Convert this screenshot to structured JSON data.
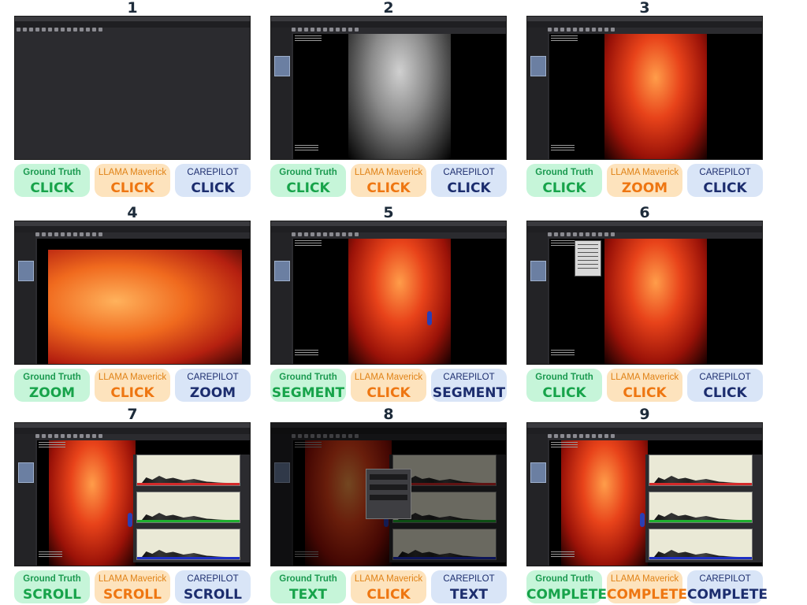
{
  "labels": {
    "ground_truth": "Ground Truth",
    "llama": "LLAMA Maverick",
    "carepilot": "CAREPILOT"
  },
  "panels": [
    {
      "number": "1",
      "ground_truth": "CLICK",
      "llama": "CLICK",
      "carepilot": "CLICK",
      "scene": "empty"
    },
    {
      "number": "2",
      "ground_truth": "CLICK",
      "llama": "CLICK",
      "carepilot": "CLICK",
      "scene": "gray-scan"
    },
    {
      "number": "3",
      "ground_truth": "CLICK",
      "llama": "ZOOM",
      "carepilot": "CLICK",
      "scene": "red-scan"
    },
    {
      "number": "4",
      "ground_truth": "ZOOM",
      "llama": "CLICK",
      "carepilot": "ZOOM",
      "scene": "zoomed"
    },
    {
      "number": "5",
      "ground_truth": "SEGMENT",
      "llama": "CLICK",
      "carepilot": "SEGMENT",
      "scene": "red-scan-seg"
    },
    {
      "number": "6",
      "ground_truth": "CLICK",
      "llama": "CLICK",
      "carepilot": "CLICK",
      "scene": "red-scan-menu"
    },
    {
      "number": "7",
      "ground_truth": "SCROLL",
      "llama": "SCROLL",
      "carepilot": "SCROLL",
      "scene": "histogram"
    },
    {
      "number": "8",
      "ground_truth": "TEXT",
      "llama": "CLICK",
      "carepilot": "TEXT",
      "scene": "dialog"
    },
    {
      "number": "9",
      "ground_truth": "COMPLETE",
      "llama": "COMPLETE",
      "carepilot": "COMPLETE",
      "scene": "histogram-final"
    }
  ],
  "colors": {
    "ground_truth_bg": "#c6f5d9",
    "ground_truth_text": "#17a34a",
    "llama_bg": "#fde3bd",
    "llama_text": "#ee7611",
    "carepilot_bg": "#d9e5f7",
    "carepilot_text": "#1c2d6e",
    "hist_red": "#d42a2a",
    "hist_green": "#1fae2f",
    "hist_blue": "#1e2fc4"
  }
}
